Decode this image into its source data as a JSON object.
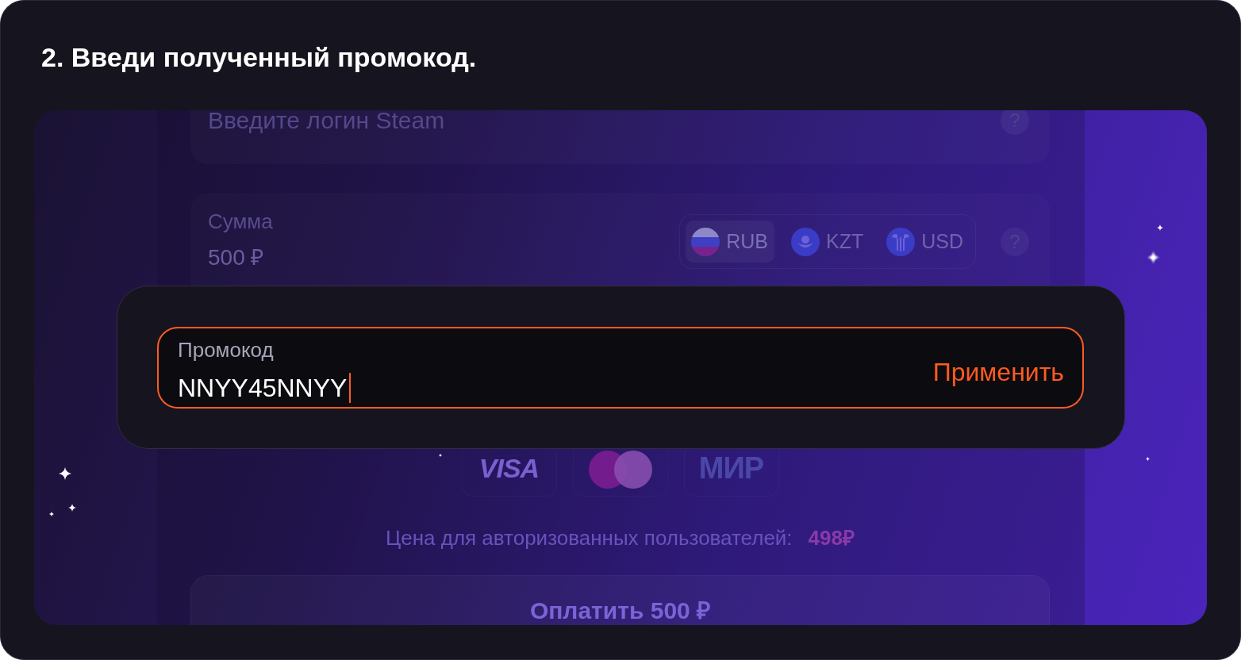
{
  "title": "2. Введи полученный промокод.",
  "form": {
    "login_field": {
      "placeholder": "Введите логин Steam",
      "help": "?"
    },
    "amount_field": {
      "label": "Сумма",
      "value": "500 ₽",
      "currencies": [
        {
          "code": "RUB",
          "kind": "striped",
          "selected": true
        },
        {
          "code": "KZT",
          "kind": "sun",
          "selected": false
        },
        {
          "code": "USD",
          "kind": "emblem",
          "selected": false
        }
      ],
      "help": "?"
    },
    "payment_methods": [
      {
        "kind": "visa",
        "label": "VISA"
      },
      {
        "kind": "circles"
      },
      {
        "kind": "mir",
        "label": "МИР"
      }
    ],
    "price_note": {
      "label": "Цена для авторизованных пользователей:",
      "price": "498₽"
    },
    "pay_button": "Оплатить 500 ₽"
  },
  "promo_card": {
    "label": "Промокод",
    "value": "NNYY45NNYY",
    "action": "Применить"
  }
}
